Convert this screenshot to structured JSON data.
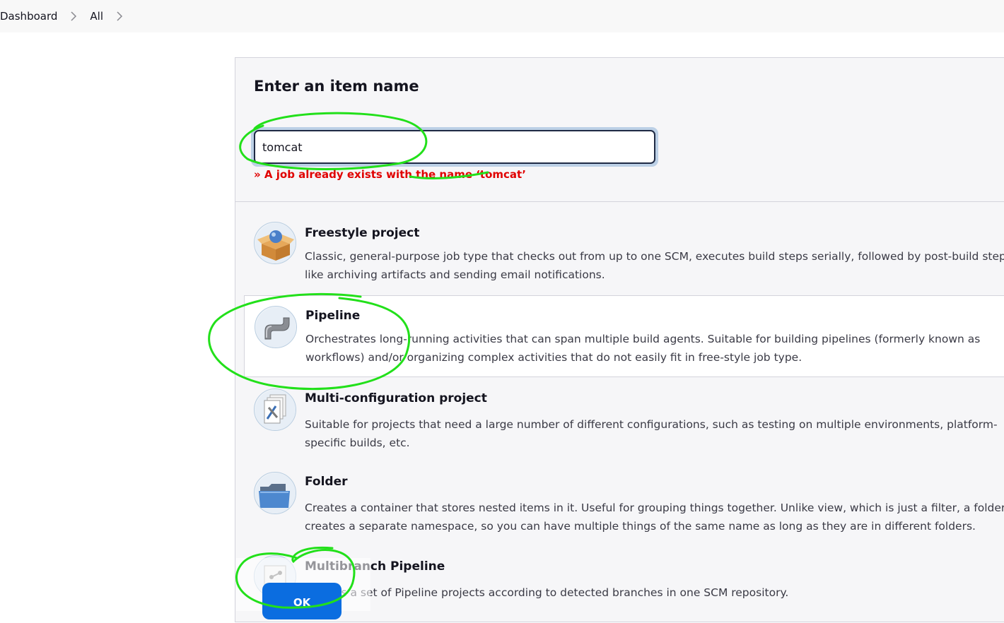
{
  "breadcrumb": {
    "items": [
      "Dashboard",
      "All"
    ]
  },
  "form": {
    "title": "Enter an item name",
    "item_name_value": "tomcat",
    "error_text": "» A job already exists with the name ‘tomcat’"
  },
  "item_types": [
    {
      "name": "Freestyle project",
      "description": "Classic, general-purpose job type that checks out from up to one SCM, executes build steps serially, followed by post-build steps like archiving artifacts and sending email notifications.",
      "icon": "freestyle-box-icon",
      "selected": false
    },
    {
      "name": "Pipeline",
      "description": "Orchestrates long-running activities that can span multiple build agents. Suitable for building pipelines (formerly known as workflows) and/or organizing complex activities that do not easily fit in free-style job type.",
      "icon": "pipeline-pipe-icon",
      "selected": true
    },
    {
      "name": "Multi-configuration project",
      "description": "Suitable for projects that need a large number of different configurations, such as testing on multiple environments, platform-specific builds, etc.",
      "icon": "multi-configuration-icon",
      "selected": false
    },
    {
      "name": "Folder",
      "description": "Creates a container that stores nested items in it. Useful for grouping things together. Unlike view, which is just a filter, a folder creates a separate namespace, so you can have multiple things of the same name as long as they are in different folders.",
      "icon": "folder-icon",
      "selected": false
    },
    {
      "name": "Multibranch Pipeline",
      "description": "Creates a set of Pipeline projects according to detected branches in one SCM repository.",
      "icon": "multibranch-pipeline-icon",
      "selected": false
    }
  ],
  "ok_button": {
    "label": "OK"
  },
  "colors": {
    "accent": "#0b6de0",
    "error": "#e00000",
    "annotation": "#22e01a"
  }
}
